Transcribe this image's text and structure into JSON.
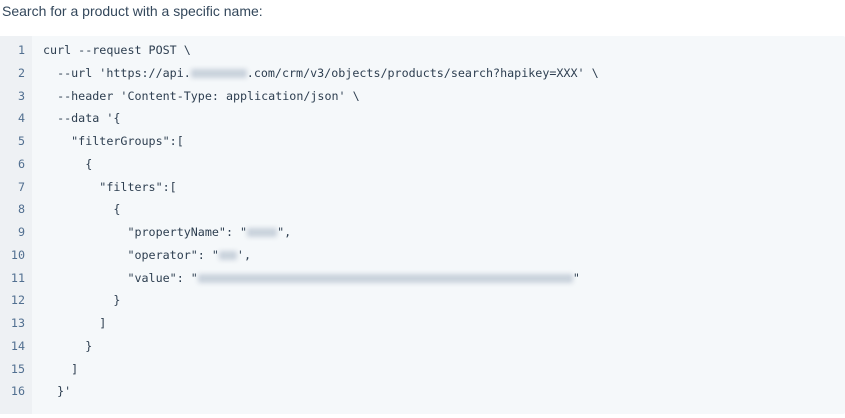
{
  "heading": "Search for a product with a specific name:",
  "code_lines": [
    {
      "n": "1",
      "parts": [
        "curl --request POST \\"
      ]
    },
    {
      "n": "2",
      "parts": [
        "  --url 'https://api.",
        {
          "redacted": 56
        },
        ".com/crm/v3/objects/products/search?hapikey=XXX' \\"
      ]
    },
    {
      "n": "3",
      "parts": [
        "  --header 'Content-Type: application/json' \\"
      ]
    },
    {
      "n": "4",
      "parts": [
        "  --data '{"
      ]
    },
    {
      "n": "5",
      "parts": [
        "    \"filterGroups\":["
      ]
    },
    {
      "n": "6",
      "parts": [
        "      {"
      ]
    },
    {
      "n": "7",
      "parts": [
        "        \"filters\":["
      ]
    },
    {
      "n": "8",
      "parts": [
        "          {"
      ]
    },
    {
      "n": "9",
      "parts": [
        "            \"propertyName\": \"",
        {
          "redacted": 30
        },
        "\","
      ]
    },
    {
      "n": "10",
      "parts": [
        "            \"operator\": \"",
        {
          "redacted": 18
        },
        "',"
      ]
    },
    {
      "n": "11",
      "parts": [
        "            \"value\": \"",
        {
          "redacted": 375
        },
        "\""
      ]
    },
    {
      "n": "12",
      "parts": [
        "          }"
      ]
    },
    {
      "n": "13",
      "parts": [
        "        ]"
      ]
    },
    {
      "n": "14",
      "parts": [
        "      }"
      ]
    },
    {
      "n": "15",
      "parts": [
        "    ]"
      ]
    },
    {
      "n": "16",
      "parts": [
        "  }'"
      ]
    }
  ]
}
